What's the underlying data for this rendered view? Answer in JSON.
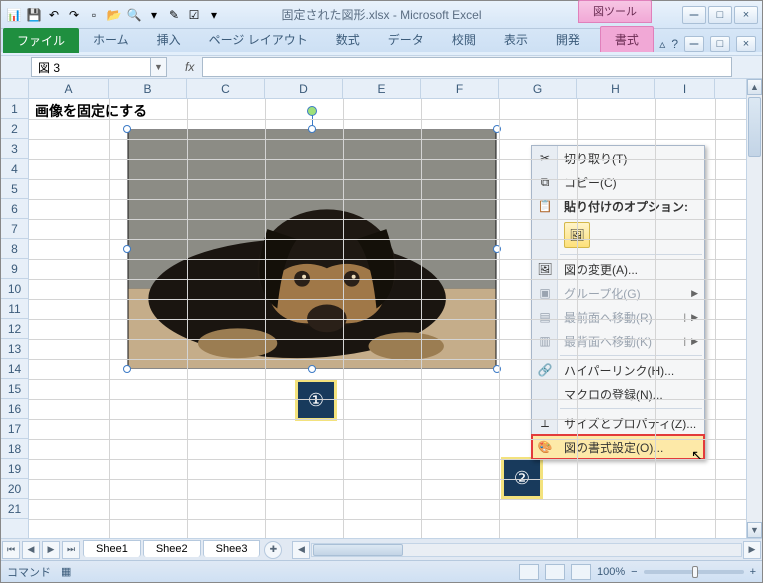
{
  "title": "固定された図形.xlsx - Microsoft Excel",
  "contextual_tool": {
    "group": "図ツール",
    "tab": "書式"
  },
  "qat_tips": [
    "excel",
    "save",
    "undo",
    "redo",
    "new",
    "open",
    "print-preview",
    "spelling",
    "sort",
    "quick-print"
  ],
  "win_controls": {
    "min": "ー",
    "max": "□",
    "close": "×",
    "help": "?",
    "ribbon_toggle": "▵"
  },
  "ribbon_tabs": [
    "ホーム",
    "挿入",
    "ページ レイアウト",
    "数式",
    "データ",
    "校閲",
    "表示",
    "開発"
  ],
  "file_tab": "ファイル",
  "namebox": "図 3",
  "fx_label": "fx",
  "columns": [
    {
      "l": "A",
      "w": 80
    },
    {
      "l": "B",
      "w": 78
    },
    {
      "l": "C",
      "w": 78
    },
    {
      "l": "D",
      "w": 78
    },
    {
      "l": "E",
      "w": 78
    },
    {
      "l": "F",
      "w": 78
    },
    {
      "l": "G",
      "w": 78
    },
    {
      "l": "H",
      "w": 78
    },
    {
      "l": "I",
      "w": 60
    }
  ],
  "rows": 21,
  "cell_A1": "画像を固定にする",
  "callouts": {
    "one": "①",
    "two": "②"
  },
  "context_menu": {
    "cut": "切り取り(T)",
    "copy": "コピー(C)",
    "paste_header": "貼り付けのオプション:",
    "change_pic": "図の変更(A)...",
    "group": "グループ化(G)",
    "bring_front": "最前面へ移動(R)",
    "send_back": "最背面へ移動(K)",
    "hyperlink": "ハイパーリンク(H)...",
    "assign_macro": "マクロの登録(N)...",
    "size_props": "サイズとプロパティ(Z)...",
    "format_pic": "図の書式設定(O)..."
  },
  "sheet_tabs": [
    "Shee1",
    "Shee2",
    "Shee3"
  ],
  "status": {
    "mode": "コマンド",
    "zoom": "100%",
    "minus": "−",
    "plus": "+"
  }
}
